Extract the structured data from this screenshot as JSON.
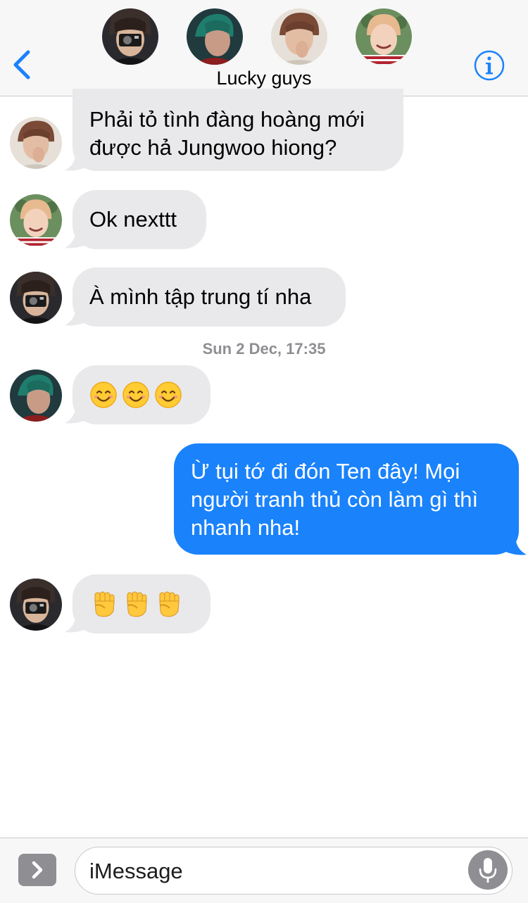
{
  "header": {
    "group_name": "Lucky guys",
    "members": [
      "member-1",
      "member-2",
      "member-3",
      "member-4"
    ],
    "back_icon": "chevron-left-icon",
    "info_icon": "info-circle-icon",
    "accent_color": "#1a82fb"
  },
  "messages": [
    {
      "sender": "member-3",
      "direction": "incoming",
      "text_line1": "Phải tỏ tình đàng hoàng mới",
      "text_line2": "được hả Jungwoo hiong?"
    },
    {
      "sender": "member-4",
      "direction": "incoming",
      "text": "Ok nexttt"
    },
    {
      "sender": "member-1",
      "direction": "incoming",
      "text": "À mình tập trung tí nha"
    },
    {
      "sender": "member-2",
      "direction": "incoming",
      "emoji": "smiling-face-emoji",
      "count": 3
    },
    {
      "direction": "outgoing",
      "text_line1": "Ừ tụi tớ đi đón Ten đây! Mọi",
      "text_line2": "người tranh thủ còn làm gì thì",
      "text_line3": "nhanh nha!"
    },
    {
      "sender": "member-1",
      "direction": "incoming",
      "emoji": "raised-fist-emoji",
      "count": 3
    }
  ],
  "timestamp": "Sun 2 Dec, 17:35",
  "composer": {
    "placeholder": "iMessage",
    "apps_icon": "chevron-right-icon",
    "mic_icon": "microphone-icon"
  },
  "colors": {
    "incoming_bubble": "#e9e9eb",
    "outgoing_bubble": "#1a82fb",
    "timestamp": "#8e8e93"
  }
}
